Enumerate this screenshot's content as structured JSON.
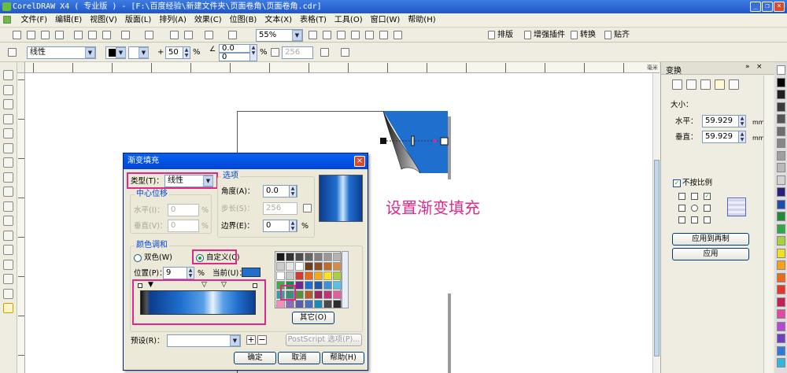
{
  "app": {
    "title": "CorelDRAW X4 ( 专业版 ) - [F:\\百度经验\\新建文件夹\\页面卷角\\页面卷角.cdr]"
  },
  "menu": [
    "文件(F)",
    "编辑(E)",
    "视图(V)",
    "版面(L)",
    "排列(A)",
    "效果(C)",
    "位图(B)",
    "文本(X)",
    "表格(T)",
    "工具(O)",
    "窗口(W)",
    "帮助(H)"
  ],
  "toolbar": {
    "zoom": "55%",
    "plugins": [
      "排版",
      "增强插件",
      "转换",
      "贴齐"
    ]
  },
  "propbar": {
    "fill_type": "线性",
    "mid": "50",
    "mid_unit": "%",
    "angle": "0.0",
    "edge": "0",
    "steps": "256"
  },
  "ruler_unit": "毫米",
  "annotation": "设置渐变填充",
  "dialog": {
    "title": "渐变填充",
    "type_label": "类型(T)：",
    "type_value": "线性",
    "center_label": "中心位移",
    "h_label": "水平(I)：",
    "h_value": "0",
    "h_unit": "%",
    "v_label": "垂直(V)：",
    "v_value": "0",
    "v_unit": "%",
    "options_label": "选项",
    "angle_label": "角度(A)：",
    "angle_value": "0.0",
    "steps_label": "步长(S)：",
    "steps_value": "256",
    "edge_label": "边界(E)：",
    "edge_value": "0",
    "edge_unit": "%",
    "blend_label": "颜色调和",
    "two_color": "双色(W)",
    "custom": "自定义(C)",
    "position_label": "位置(P)：",
    "position_value": "9",
    "position_unit": "%",
    "current_label": "当前(U)：",
    "current_color": "#1f6fcf",
    "others_btn": "其它(O)",
    "preset_label": "预设(R)：",
    "postscript_btn": "PostScript 选项(P)...",
    "ok": "确定",
    "cancel": "取消",
    "help": "帮助(H)"
  },
  "docker": {
    "title": "变换",
    "size_label": "大小：",
    "h_label": "水平：",
    "h_value": "59.929",
    "h_unit": "mm",
    "v_label": "垂直：",
    "v_value": "59.929",
    "v_unit": "mm",
    "nonprop": "不按比例",
    "apply_dup": "应用到再制",
    "apply": "应用"
  },
  "palette_colors": [
    "#ffffff",
    "#000000",
    "#1f1f1f",
    "#3a3a3a",
    "#555555",
    "#6e6e6e",
    "#878787",
    "#a0a0a0",
    "#b9b9b9",
    "#d2d2d2",
    "#2a1f7a",
    "#1e4db0",
    "#1f8a3a",
    "#2fa84a",
    "#a8d13a",
    "#f0e020",
    "#f4a21c",
    "#ee6a1a",
    "#e5372a",
    "#c81e55",
    "#e04aa0",
    "#b44ad0",
    "#6e3fc0",
    "#2f79d8",
    "#33b5e0"
  ],
  "mini_palette": [
    "#1a1a1a",
    "#333333",
    "#4d4d4d",
    "#666666",
    "#808080",
    "#999999",
    "#b3b3b3",
    "#cccccc",
    "#e6e6e6",
    "#ffffff",
    "#6b3d1e",
    "#8f4f24",
    "#c06a30",
    "#d68a4c",
    "#ffffff",
    "#c9c9c9",
    "#d53a2e",
    "#e86a1f",
    "#f5a71c",
    "#ffe11f",
    "#a9cf3c",
    "#3fae49",
    "#208a48",
    "#6e2a8c",
    "#1f6fcf",
    "#1e5aa8",
    "#3b92d8",
    "#59c1e6",
    "#2aa6a0",
    "#3a8f7a",
    "#5f8d3a",
    "#b65c2c",
    "#9a2a5a",
    "#c0327d",
    "#e35ea0",
    "#f08fb8",
    "#8c6bb8",
    "#5b5db0",
    "#4b70c0",
    "#1b8bb8",
    "#4a4a4a",
    "#2c2c2c",
    "#0b5c8e",
    "#3276b8",
    "#5b9ad4",
    "#8cbbe6",
    "#1f8e8e",
    "#2d6e4e",
    "#c8a23a",
    "#e0c25a",
    "#f0dc8a",
    "#fff1b8",
    "#c87d6a",
    "#a2564a",
    "#7a3a3a",
    "#3a2a5a",
    "#4a4a8a",
    "#6a6aa8",
    "#9a9ac8",
    "#c8c8e8"
  ]
}
